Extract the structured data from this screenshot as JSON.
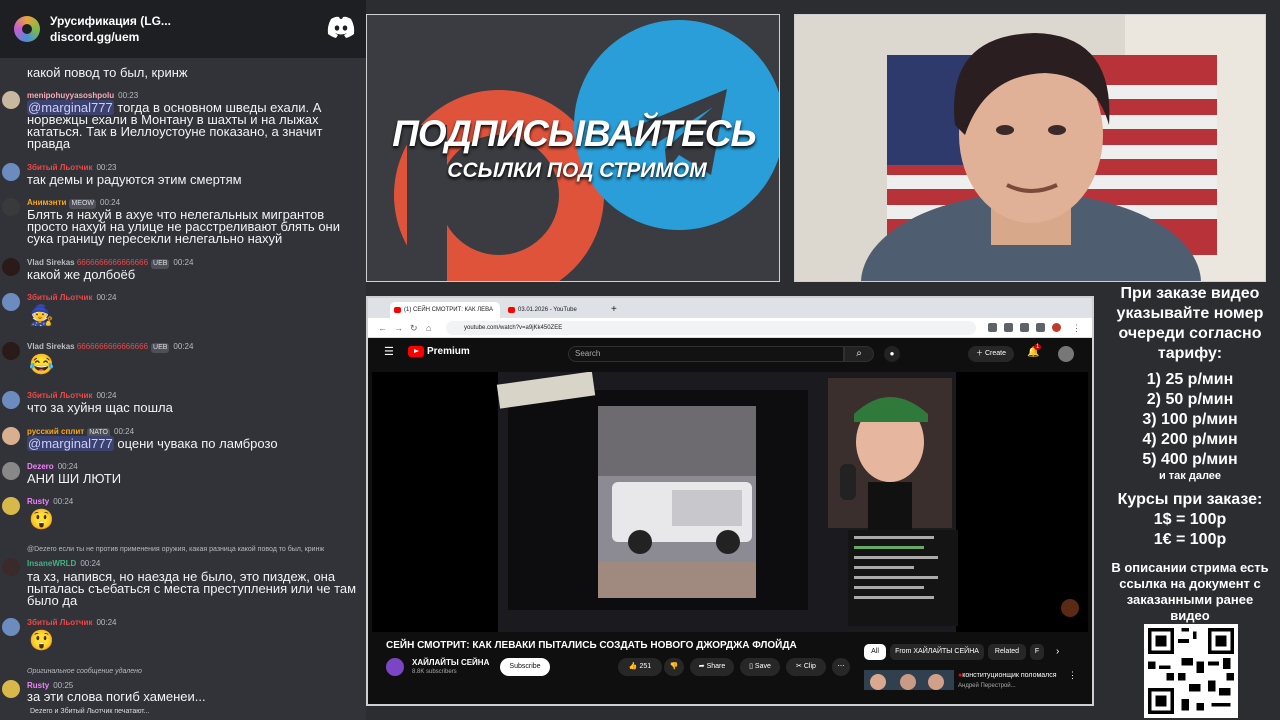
{
  "chat": {
    "server_name": "Урусификация (LG...",
    "server_invite": "discord.gg/uem",
    "top_text": "какой повод то был, кринж",
    "messages": [
      {
        "user": "menipohuyyasoshpolu",
        "user_color": "#f5a9b8",
        "time": "00:23",
        "text_mention": "@marginal777",
        "text": " тогда в основном шведы ехали. А норвежцы ехали в Монтану в шахты и на лыжах кататься. Так в Иеллоустоуне показано, а значит правда"
      },
      {
        "user": "Збитый Льотчик",
        "user_color": "#f04747",
        "time": "00:23",
        "text": "так демы и радуются этим смертям"
      },
      {
        "user": "Анимэнти",
        "user_color": "#faa61a",
        "badge": "MEOW",
        "time": "00:24",
        "text": "Блять я нахуй в ахуе что нелегальных мигрантов просто нахуй на улице не расстреливают блять они сука границу пересекли нелегально нахуй"
      },
      {
        "user": "Vlad Sirekas",
        "suffix": "6666666666666666",
        "user_color": "#b9bbbe",
        "badge": "UEB",
        "time": "00:24",
        "text": "какой же долбоёб"
      },
      {
        "user": "Збитый Льотчик",
        "user_color": "#f04747",
        "time": "00:24",
        "emoji": "🧙"
      },
      {
        "user": "Vlad Sirekas",
        "suffix": "6666666666666666",
        "user_color": "#b9bbbe",
        "badge": "UEB",
        "time": "00:24",
        "emoji": "😂"
      },
      {
        "user": "Збитый Льотчик",
        "user_color": "#f04747",
        "time": "00:24",
        "text": "что за хуйня щас пошла"
      },
      {
        "user": "русский сплит",
        "user_color": "#faa61a",
        "badge": "NATO",
        "time": "00:24",
        "text_mention": "@marginal777",
        "text": " оцени чувака по ламброзо"
      },
      {
        "user": "Dezero",
        "user_color": "#f47fff",
        "time": "00:24",
        "text": "АНИ ШИ ЛЮТИ"
      },
      {
        "user": "Rusty",
        "user_color": "#f47fff",
        "time": "00:24",
        "emoji": "😲"
      },
      {
        "reply": "@Dezero если ты не против применения оружия, какая разница какой повод то был, кринж",
        "user": "InsaneWRLD",
        "user_color": "#43b581",
        "time": "00:24",
        "text": "та хз, напився, но наезда не было, это пиздеж, она пыталась съебаться с места преступления или че там было да"
      },
      {
        "user": "Збитый Льотчик",
        "user_color": "#f04747",
        "time": "00:24",
        "emoji": "😲"
      },
      {
        "reply": "Оригинальное сообщение удалено",
        "user": "Rusty",
        "user_color": "#f47fff",
        "time": "00:25",
        "text": "за эти слова погиб хаменеи..."
      }
    ],
    "typing": "Dezero и Збитый Льотчик печатают..."
  },
  "promo": {
    "line1": "ПОДПИСЫВАЙТЕСЬ",
    "line2": "ССЫЛКИ ПОД СТРИМОМ",
    "patreon_color": "#e0533b",
    "telegram_color": "#2a9ed9"
  },
  "side_info": {
    "intro": "При заказе видео указывайте номер очереди согласно тарифу:",
    "tariffs": [
      "1) 25 р/мин",
      "2) 50 р/мин",
      "3) 100 р/мин",
      "4) 200 р/мин",
      "5) 400 р/мин"
    ],
    "tariffs_more": "и так далее",
    "rates_title": "Курсы при заказе:",
    "rates": [
      "1$ = 100р",
      "1€ = 100р"
    ],
    "note": "В описании стрима есть ссылка на документ с заказанными ранее видео"
  },
  "browser": {
    "tabs": [
      {
        "title": "(1) СЕЙН СМОТРИТ: КАК ЛЕВА",
        "active": true
      },
      {
        "title": "03.01.2026 - YouTube",
        "active": false
      }
    ],
    "url": "youtube.com/watch?v=a9jKk450ZEE",
    "yt": {
      "brand": "Premium",
      "search_placeholder": "Search",
      "create": "Create",
      "notifications": "1",
      "video_title": "СЕЙН СМОТРИТ: КАК ЛЕВАКИ ПЫТАЛИСЬ СОЗДАТЬ НОВОГО ДЖОРДЖА ФЛОЙДА",
      "channel": "ХАЙЛАЙТЫ СЕЙНА",
      "subscribers": "8.8K subscribers",
      "subscribe": "Subscribe",
      "likes": "251",
      "share": "Share",
      "save": "Save",
      "clip": "Clip",
      "chips": [
        "All",
        "From ХАЙЛАЙТЫ СЕЙНА",
        "Related",
        "F"
      ],
      "related_title": "конституционщик поломался",
      "related_sub": "Андрей Перестрой..."
    }
  }
}
